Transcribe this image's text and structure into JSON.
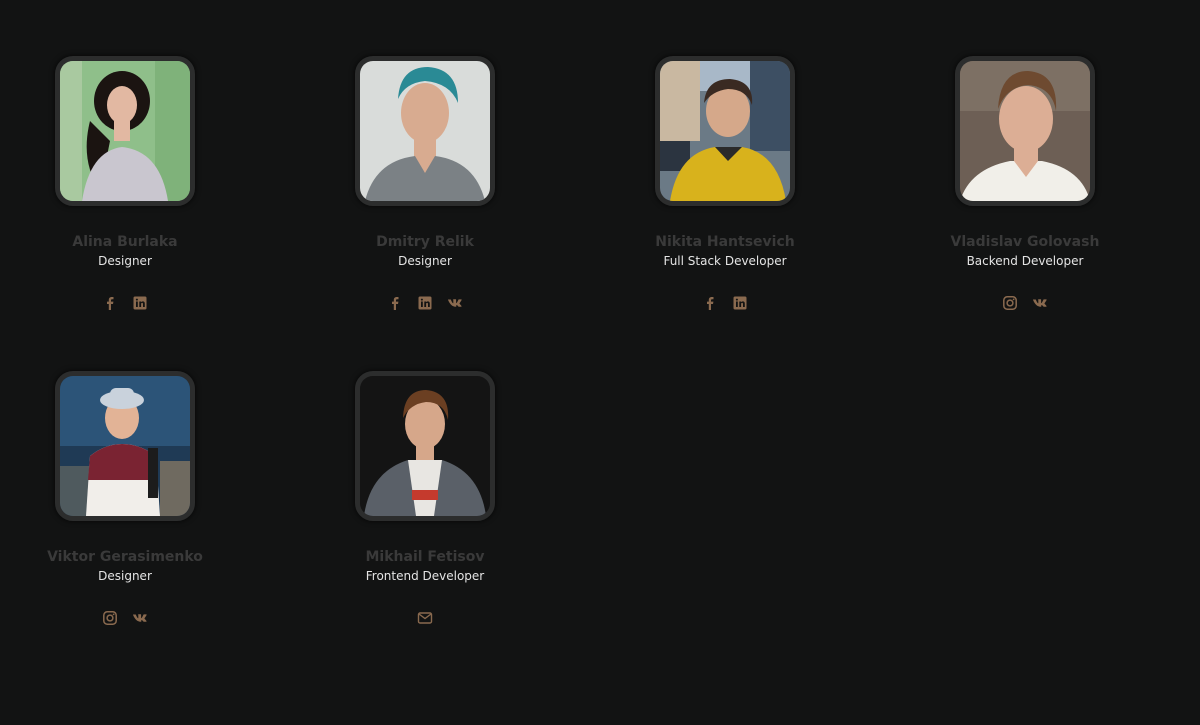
{
  "colors": {
    "background": "#121313",
    "name_text": "#3a3a3a",
    "role_text": "#e4e4e4",
    "icon_accent": "#8a6a4f"
  },
  "members": [
    {
      "name": "Alina Burlaka",
      "role": "Designer",
      "socials": [
        "facebook-icon",
        "linkedin-icon"
      ]
    },
    {
      "name": "Dmitry Relik",
      "role": "Designer",
      "socials": [
        "facebook-icon",
        "linkedin-icon",
        "vk-icon"
      ]
    },
    {
      "name": "Nikita Hantsevich",
      "role": "Full Stack Developer",
      "socials": [
        "facebook-icon",
        "linkedin-icon"
      ]
    },
    {
      "name": "Vladislav Golovash",
      "role": "Backend Developer",
      "socials": [
        "instagram-icon",
        "vk-icon"
      ]
    },
    {
      "name": "Viktor Gerasimenko",
      "role": "Designer",
      "socials": [
        "instagram-icon",
        "vk-icon"
      ]
    },
    {
      "name": "Mikhail Fetisov",
      "role": "Frontend Developer",
      "socials": [
        "email-icon"
      ]
    }
  ]
}
